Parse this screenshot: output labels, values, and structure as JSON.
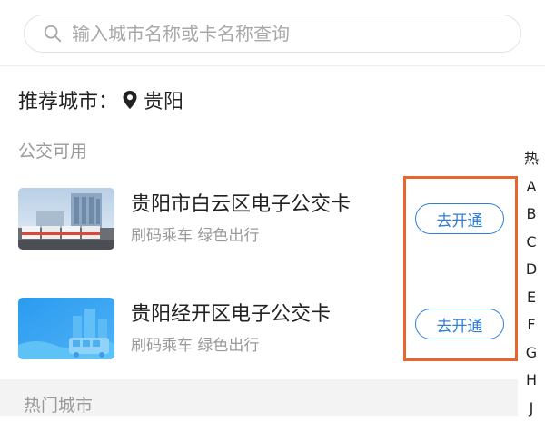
{
  "search": {
    "placeholder": "输入城市名称或卡名称查询",
    "value": ""
  },
  "recommend": {
    "label": "推荐城市：",
    "city": "贵阳"
  },
  "section": {
    "label": "公交可用"
  },
  "cards": [
    {
      "title": "贵阳市白云区电子公交卡",
      "subtitle": "刷码乘车  绿色出行",
      "button": "去开通"
    },
    {
      "title": "贵阳经开区电子公交卡",
      "subtitle": "刷码乘车  绿色出行",
      "button": "去开通"
    }
  ],
  "hot": {
    "label": "热门城市"
  },
  "index": [
    "热",
    "A",
    "B",
    "C",
    "D",
    "E",
    "F",
    "G",
    "H",
    "J"
  ],
  "colors": {
    "accent": "#2f7ed8",
    "highlight": "#e8652f",
    "muted": "#9a9a9a"
  },
  "icons": {
    "search": "search-icon",
    "pin": "location-pin-icon"
  }
}
